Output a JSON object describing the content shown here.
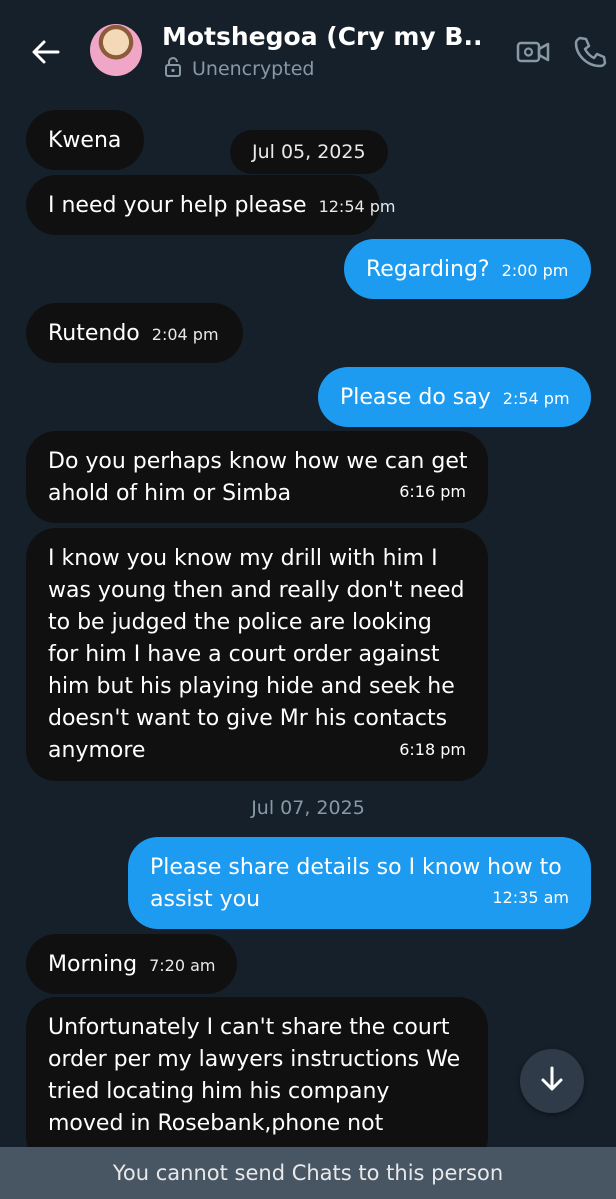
{
  "header": {
    "title": "Motshegoa (Cry my B...",
    "encryption_status": "Unencrypted"
  },
  "messages": [
    {
      "id": "m1",
      "direction": "in",
      "text": "Kwena",
      "time": ""
    },
    {
      "id": "m2",
      "direction": "in",
      "text": "I need your help please",
      "time": "12:54 pm"
    },
    {
      "id": "m3",
      "direction": "out",
      "text": "Regarding?",
      "time": "2:00 pm"
    },
    {
      "id": "m4",
      "direction": "in",
      "text": "Rutendo",
      "time": "2:04 pm"
    },
    {
      "id": "m5",
      "direction": "out",
      "text": "Please do say",
      "time": "2:54 pm"
    },
    {
      "id": "m6",
      "direction": "in",
      "text": "Do you perhaps know how we can get ahold of him or Simba",
      "time": "6:16 pm"
    },
    {
      "id": "m7",
      "direction": "in",
      "text": "I know you know my drill with him I was young then and really don't need to be judged the police are looking for him I have a court order against him but his playing hide and seek he doesn't want to give Mr his contacts anymore",
      "time": "6:18 pm"
    },
    {
      "id": "m8",
      "direction": "out",
      "text": "Please share details so I know how to assist you",
      "time": "12:35 am"
    },
    {
      "id": "m9",
      "direction": "in",
      "text": "Morning",
      "time": "7:20 am"
    },
    {
      "id": "m10",
      "direction": "in",
      "text": "Unfortunately I can't share the court order per my lawyers instructions We tried locating him his company moved in Rosebank,phone not",
      "time": ""
    }
  ],
  "dates": {
    "first": "Jul 05, 2025",
    "second": "Jul 07, 2025"
  },
  "footer": {
    "notice": "You cannot send Chats to this person"
  },
  "colors": {
    "background": "#15202b",
    "incoming_bubble": "#101010",
    "outgoing_bubble": "#1d9bf0",
    "footer": "#485563"
  }
}
